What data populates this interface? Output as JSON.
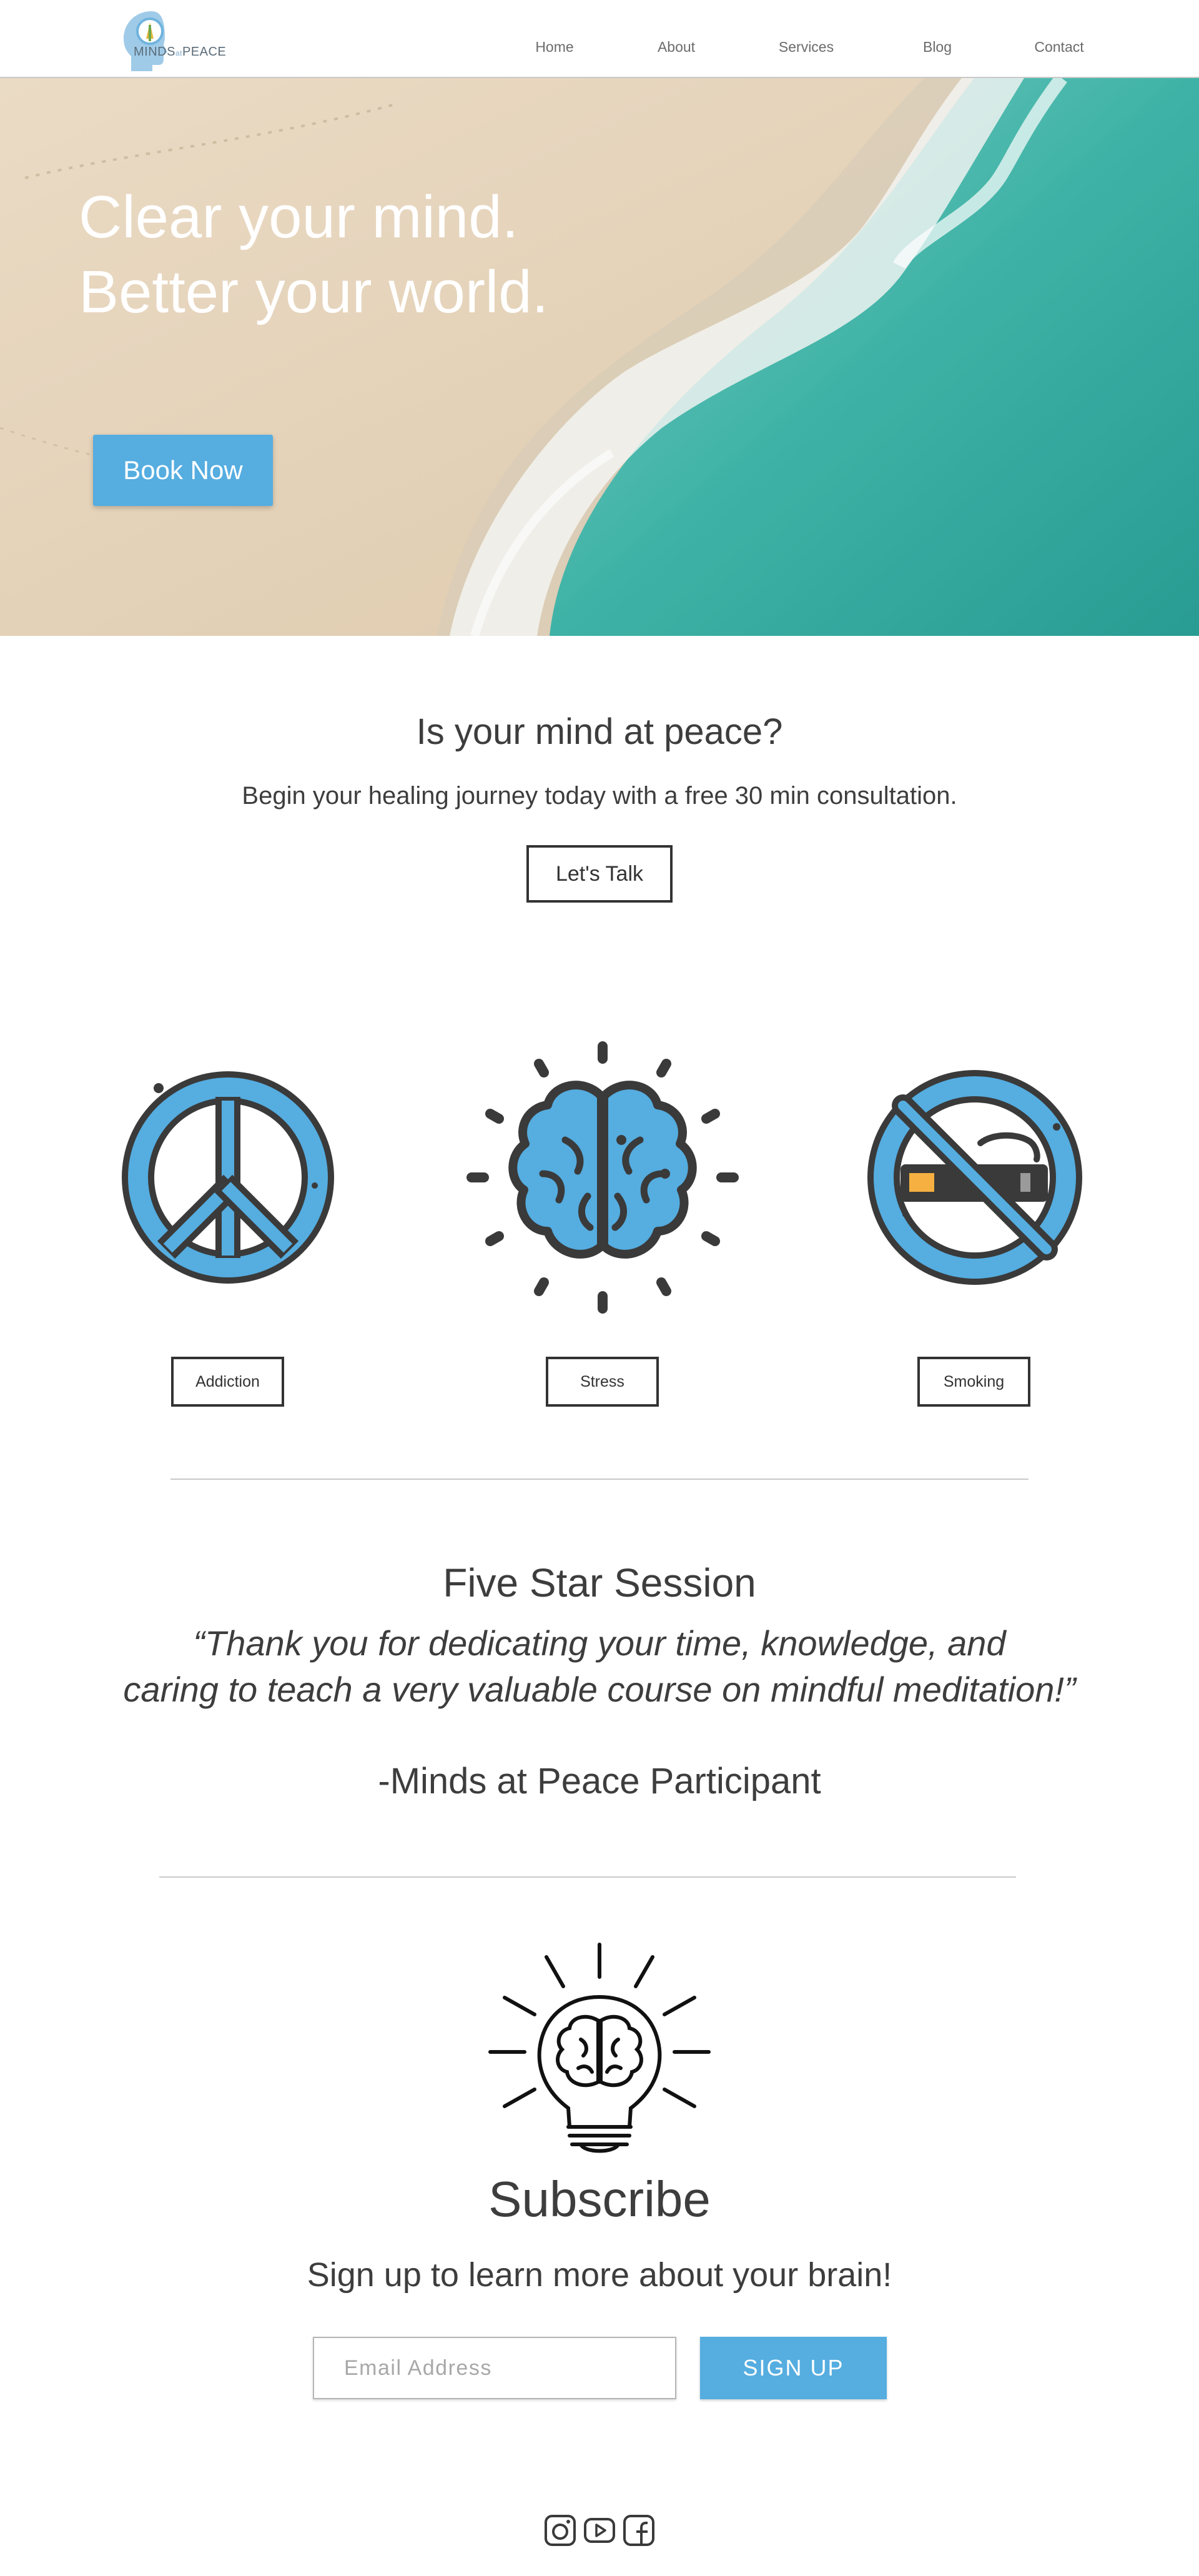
{
  "header": {
    "logo_main": "MINDS",
    "logo_small": "at",
    "logo_end": "PEACE",
    "nav": [
      "Home",
      "About",
      "Services",
      "Blog",
      "Contact"
    ]
  },
  "hero": {
    "line1": "Clear your mind.",
    "line2": "Better your world.",
    "cta": "Book Now"
  },
  "peace": {
    "heading": "Is your mind at peace?",
    "subtext": "Begin your healing journey today with a free 30 min consultation.",
    "button": "Let's Talk"
  },
  "services": [
    {
      "label": "Addiction",
      "icon": "peace-sign-icon"
    },
    {
      "label": "Stress",
      "icon": "brain-icon"
    },
    {
      "label": "Smoking",
      "icon": "no-smoking-icon"
    }
  ],
  "testimonial": {
    "heading": "Five Star Session",
    "quote_line1": "“Thank you for dedicating your time, knowledge, and",
    "quote_line2": "caring to teach a very valuable course on mindful meditation!”",
    "author": "-Minds at Peace Participant"
  },
  "subscribe": {
    "heading": "Subscribe",
    "subtext": "Sign up to learn more about your brain!",
    "email_placeholder": "Email Address",
    "button": "SIGN UP"
  },
  "social": [
    "instagram-icon",
    "youtube-icon",
    "facebook-icon"
  ],
  "colors": {
    "accent": "#55ade0",
    "text": "#3d3d3d",
    "icon_dark": "#3a3a3a",
    "icon_blue": "#55ade0"
  }
}
